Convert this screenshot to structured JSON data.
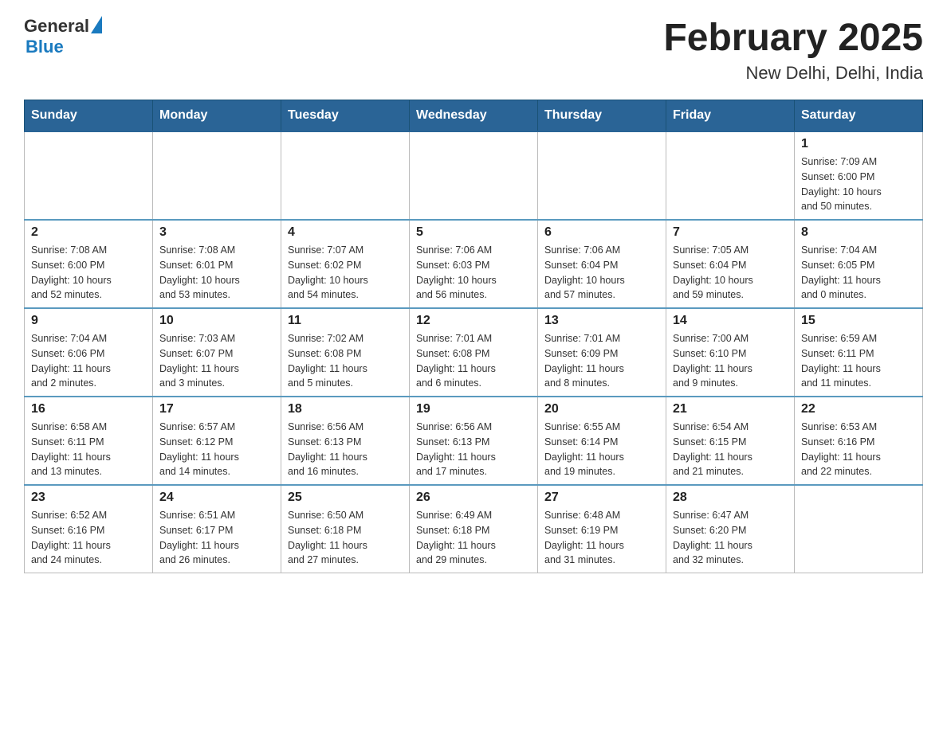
{
  "header": {
    "logo": {
      "part1": "General",
      "part2": "Blue"
    },
    "month_title": "February 2025",
    "location": "New Delhi, Delhi, India"
  },
  "days_of_week": [
    "Sunday",
    "Monday",
    "Tuesday",
    "Wednesday",
    "Thursday",
    "Friday",
    "Saturday"
  ],
  "weeks": [
    [
      {
        "day": "",
        "info": ""
      },
      {
        "day": "",
        "info": ""
      },
      {
        "day": "",
        "info": ""
      },
      {
        "day": "",
        "info": ""
      },
      {
        "day": "",
        "info": ""
      },
      {
        "day": "",
        "info": ""
      },
      {
        "day": "1",
        "info": "Sunrise: 7:09 AM\nSunset: 6:00 PM\nDaylight: 10 hours\nand 50 minutes."
      }
    ],
    [
      {
        "day": "2",
        "info": "Sunrise: 7:08 AM\nSunset: 6:00 PM\nDaylight: 10 hours\nand 52 minutes."
      },
      {
        "day": "3",
        "info": "Sunrise: 7:08 AM\nSunset: 6:01 PM\nDaylight: 10 hours\nand 53 minutes."
      },
      {
        "day": "4",
        "info": "Sunrise: 7:07 AM\nSunset: 6:02 PM\nDaylight: 10 hours\nand 54 minutes."
      },
      {
        "day": "5",
        "info": "Sunrise: 7:06 AM\nSunset: 6:03 PM\nDaylight: 10 hours\nand 56 minutes."
      },
      {
        "day": "6",
        "info": "Sunrise: 7:06 AM\nSunset: 6:04 PM\nDaylight: 10 hours\nand 57 minutes."
      },
      {
        "day": "7",
        "info": "Sunrise: 7:05 AM\nSunset: 6:04 PM\nDaylight: 10 hours\nand 59 minutes."
      },
      {
        "day": "8",
        "info": "Sunrise: 7:04 AM\nSunset: 6:05 PM\nDaylight: 11 hours\nand 0 minutes."
      }
    ],
    [
      {
        "day": "9",
        "info": "Sunrise: 7:04 AM\nSunset: 6:06 PM\nDaylight: 11 hours\nand 2 minutes."
      },
      {
        "day": "10",
        "info": "Sunrise: 7:03 AM\nSunset: 6:07 PM\nDaylight: 11 hours\nand 3 minutes."
      },
      {
        "day": "11",
        "info": "Sunrise: 7:02 AM\nSunset: 6:08 PM\nDaylight: 11 hours\nand 5 minutes."
      },
      {
        "day": "12",
        "info": "Sunrise: 7:01 AM\nSunset: 6:08 PM\nDaylight: 11 hours\nand 6 minutes."
      },
      {
        "day": "13",
        "info": "Sunrise: 7:01 AM\nSunset: 6:09 PM\nDaylight: 11 hours\nand 8 minutes."
      },
      {
        "day": "14",
        "info": "Sunrise: 7:00 AM\nSunset: 6:10 PM\nDaylight: 11 hours\nand 9 minutes."
      },
      {
        "day": "15",
        "info": "Sunrise: 6:59 AM\nSunset: 6:11 PM\nDaylight: 11 hours\nand 11 minutes."
      }
    ],
    [
      {
        "day": "16",
        "info": "Sunrise: 6:58 AM\nSunset: 6:11 PM\nDaylight: 11 hours\nand 13 minutes."
      },
      {
        "day": "17",
        "info": "Sunrise: 6:57 AM\nSunset: 6:12 PM\nDaylight: 11 hours\nand 14 minutes."
      },
      {
        "day": "18",
        "info": "Sunrise: 6:56 AM\nSunset: 6:13 PM\nDaylight: 11 hours\nand 16 minutes."
      },
      {
        "day": "19",
        "info": "Sunrise: 6:56 AM\nSunset: 6:13 PM\nDaylight: 11 hours\nand 17 minutes."
      },
      {
        "day": "20",
        "info": "Sunrise: 6:55 AM\nSunset: 6:14 PM\nDaylight: 11 hours\nand 19 minutes."
      },
      {
        "day": "21",
        "info": "Sunrise: 6:54 AM\nSunset: 6:15 PM\nDaylight: 11 hours\nand 21 minutes."
      },
      {
        "day": "22",
        "info": "Sunrise: 6:53 AM\nSunset: 6:16 PM\nDaylight: 11 hours\nand 22 minutes."
      }
    ],
    [
      {
        "day": "23",
        "info": "Sunrise: 6:52 AM\nSunset: 6:16 PM\nDaylight: 11 hours\nand 24 minutes."
      },
      {
        "day": "24",
        "info": "Sunrise: 6:51 AM\nSunset: 6:17 PM\nDaylight: 11 hours\nand 26 minutes."
      },
      {
        "day": "25",
        "info": "Sunrise: 6:50 AM\nSunset: 6:18 PM\nDaylight: 11 hours\nand 27 minutes."
      },
      {
        "day": "26",
        "info": "Sunrise: 6:49 AM\nSunset: 6:18 PM\nDaylight: 11 hours\nand 29 minutes."
      },
      {
        "day": "27",
        "info": "Sunrise: 6:48 AM\nSunset: 6:19 PM\nDaylight: 11 hours\nand 31 minutes."
      },
      {
        "day": "28",
        "info": "Sunrise: 6:47 AM\nSunset: 6:20 PM\nDaylight: 11 hours\nand 32 minutes."
      },
      {
        "day": "",
        "info": ""
      }
    ]
  ]
}
